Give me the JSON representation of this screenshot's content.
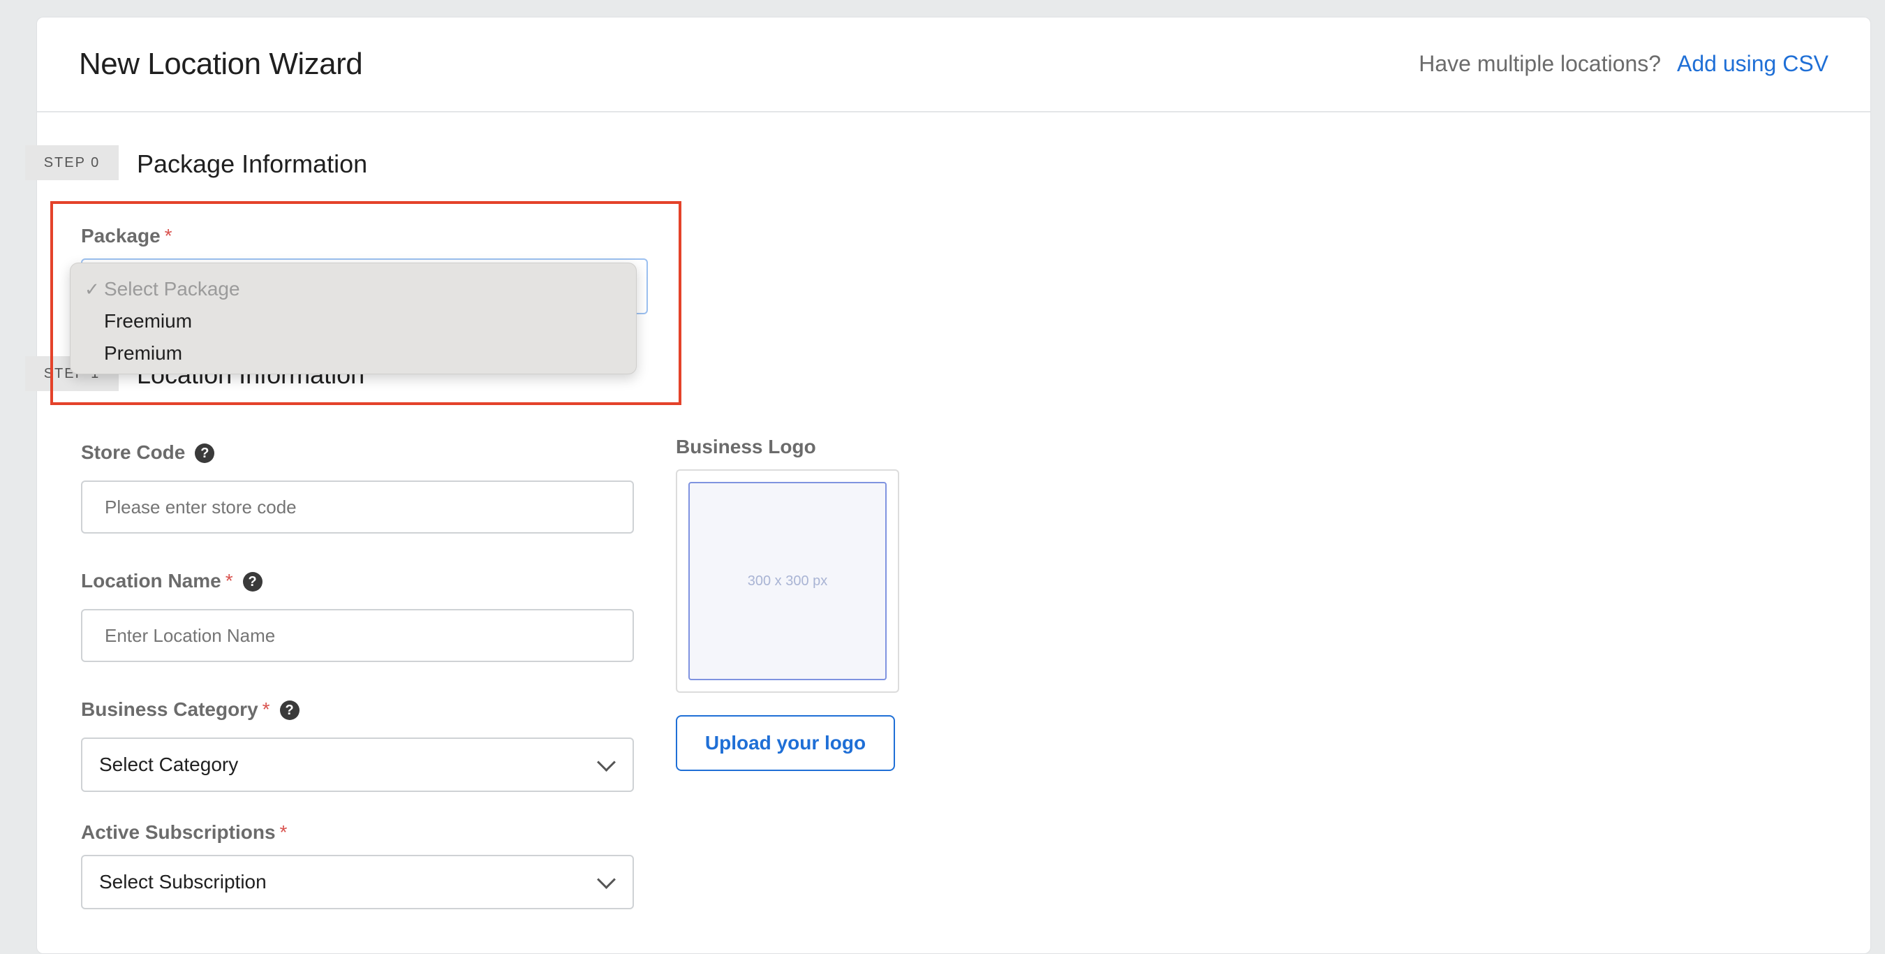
{
  "header": {
    "title": "New Location Wizard",
    "multiple_prompt": "Have multiple locations?",
    "csv_link": "Add using CSV"
  },
  "step0": {
    "tag": "STEP 0",
    "title": "Package Information",
    "package_label": "Package",
    "required_mark": "*",
    "dropdown_options": [
      {
        "label": "Select Package",
        "selected": true
      },
      {
        "label": "Freemium",
        "selected": false
      },
      {
        "label": "Premium",
        "selected": false
      }
    ],
    "check_glyph": "✓"
  },
  "step1": {
    "tag": "STEP 1",
    "title": "Location Information",
    "store_code_label": "Store Code",
    "store_code_placeholder": "Please enter store code",
    "location_name_label": "Location Name",
    "location_name_placeholder": "Enter Location Name",
    "business_category_label": "Business Category",
    "business_category_value": "Select Category",
    "active_subscriptions_label": "Active Subscriptions",
    "active_subscriptions_value": "Select Subscription",
    "business_logo_label": "Business Logo",
    "logo_placeholder": "300 x 300 px",
    "upload_button": "Upload your logo",
    "help_glyph": "?"
  },
  "colors": {
    "accent": "#1f6fd6",
    "required": "#d9534f",
    "highlight": "#e4422a"
  }
}
